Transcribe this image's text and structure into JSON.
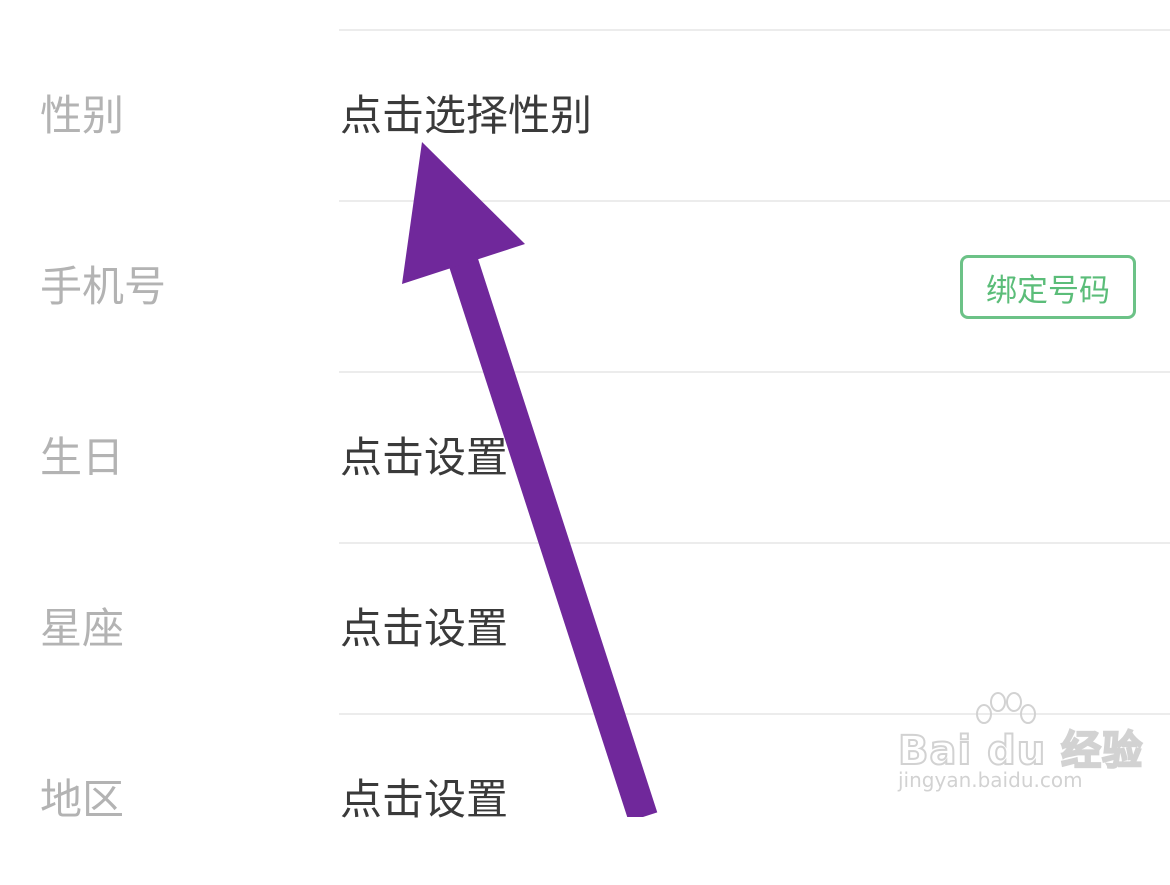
{
  "rows": [
    {
      "label": "性别",
      "value": "点击选择性别"
    },
    {
      "label": "手机号",
      "value": "",
      "button": "绑定号码"
    },
    {
      "label": "生日",
      "value": "点击设置"
    },
    {
      "label": "星座",
      "value": "点击设置"
    },
    {
      "label": "地区",
      "value": "点击设置"
    }
  ],
  "annotation": {
    "arrow_color": "#70289b"
  },
  "watermark": {
    "logo": "Bai du 经验",
    "url": "jingyan.baidu.com"
  },
  "colors": {
    "label": "#b3b3b3",
    "value": "#3a3a3a",
    "button_green": "#5bbd79",
    "divider": "#ececec"
  }
}
